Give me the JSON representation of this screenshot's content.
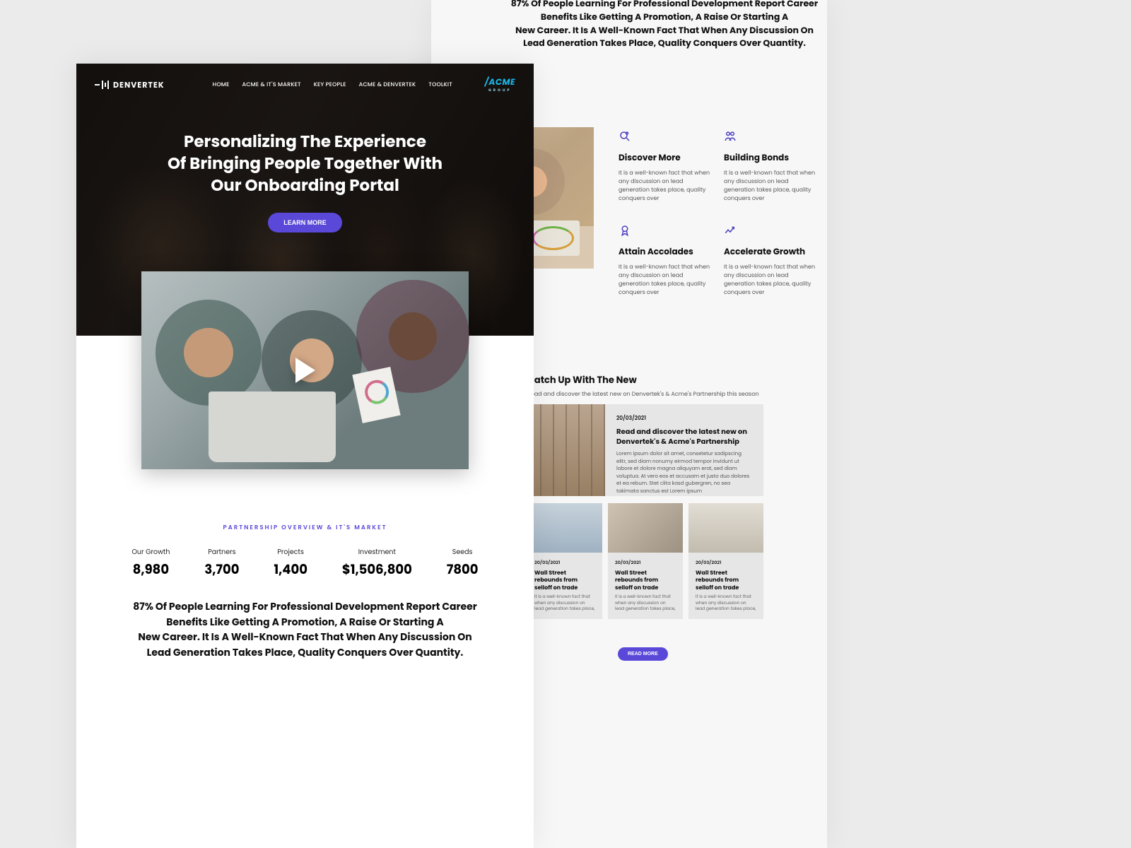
{
  "brand": {
    "name": "DENVERTEK",
    "partner": "ACME",
    "partner_sub": "GROUP"
  },
  "nav": {
    "items": [
      {
        "label": "HOME"
      },
      {
        "label": "ACME & IT'S MARKET"
      },
      {
        "label": "KEY PEOPLE"
      },
      {
        "label": "ACME & DENVERTEK"
      },
      {
        "label": "TOOLKIT"
      }
    ]
  },
  "hero": {
    "line1": "Personalizing The Experience",
    "line2": "Of Bringing People Together With",
    "line3": "Our Onboarding Portal",
    "cta": "LEARN MORE"
  },
  "stats": {
    "eyebrow": "PARTNERSHIP OVERVIEW & IT'S MARKET",
    "items": [
      {
        "label": "Our Growth",
        "value": "8,980"
      },
      {
        "label": "Partners",
        "value": "3,700"
      },
      {
        "label": "Projects",
        "value": "1,400"
      },
      {
        "label": "Investment",
        "value": "$1,506,800"
      },
      {
        "label": "Seeds",
        "value": "7800"
      }
    ],
    "paragraph_l1": "87% Of People Learning For Professional Development Report Career",
    "paragraph_l2": "Benefits Like Getting A Promotion, A Raise Or Starting A",
    "paragraph_l3": "New Career. It Is A Well-Known Fact That When Any Discussion On",
    "paragraph_l4": "Lead Generation Takes Place, Quality Conquers Over Quantity."
  },
  "rp_headline": {
    "l1": "87% Of People Learning For Professional Development Report Career",
    "l2": "Benefits Like Getting A Promotion, A Raise Or Starting A",
    "l3": "New Career. It Is A Well-Known Fact That When Any Discussion On",
    "l4": "Lead Generation Takes Place, Quality Conquers Over Quantity."
  },
  "features": [
    {
      "icon": "discover-icon",
      "title": "Discover More",
      "desc": "It is a well-known fact that when any discussion on lead generation takes place, quality conquers over"
    },
    {
      "icon": "bonds-icon",
      "title": "Building Bonds",
      "desc": "It is a well-known fact that when any discussion on lead generation takes place, quality conquers over"
    },
    {
      "icon": "accolades-icon",
      "title": "Attain Accolades",
      "desc": "It is a well-known fact that when any discussion on lead generation takes place, quality conquers over"
    },
    {
      "icon": "growth-icon",
      "title": "Accelerate Growth",
      "desc": "It is a well-known fact that when any discussion on lead generation takes place, quality conquers over"
    }
  ],
  "news": {
    "heading": "Catch Up With The New",
    "sub": "Read and discover the latest new on Denvertek's & Acme's Partnership this season",
    "featured": {
      "date": "20/03/2021",
      "title": "Read and discover the latest new on Denvertek's & Acme's Partnership",
      "body": "Lorem ipsum dolor sit amet, consetetur sadipscing elitr, sed diam nonumy eirmod tempor invidunt ut labore et dolore magna aliquyam erat, sed diam voluptua. At vero eos et accusam et justo duo dolores et ea rebum. Stet clita kasd gubergren, no sea takimata sanctus est Lorem ipsum"
    },
    "cards": [
      {
        "date": "20/03/2021",
        "title": "Wall Street rebounds from selloff on trade",
        "desc": "It is a well-known fact that when any discussion on lead generation takes place,"
      },
      {
        "date": "20/03/2021",
        "title": "Wall Street rebounds from selloff on trade",
        "desc": "It is a well-known fact that when any discussion on lead generation takes place,"
      },
      {
        "date": "20/03/2021",
        "title": "Wall Street rebounds from selloff on trade",
        "desc": "It is a well-known fact that when any discussion on lead generation takes place,"
      }
    ],
    "read_more": "READ MORE"
  }
}
